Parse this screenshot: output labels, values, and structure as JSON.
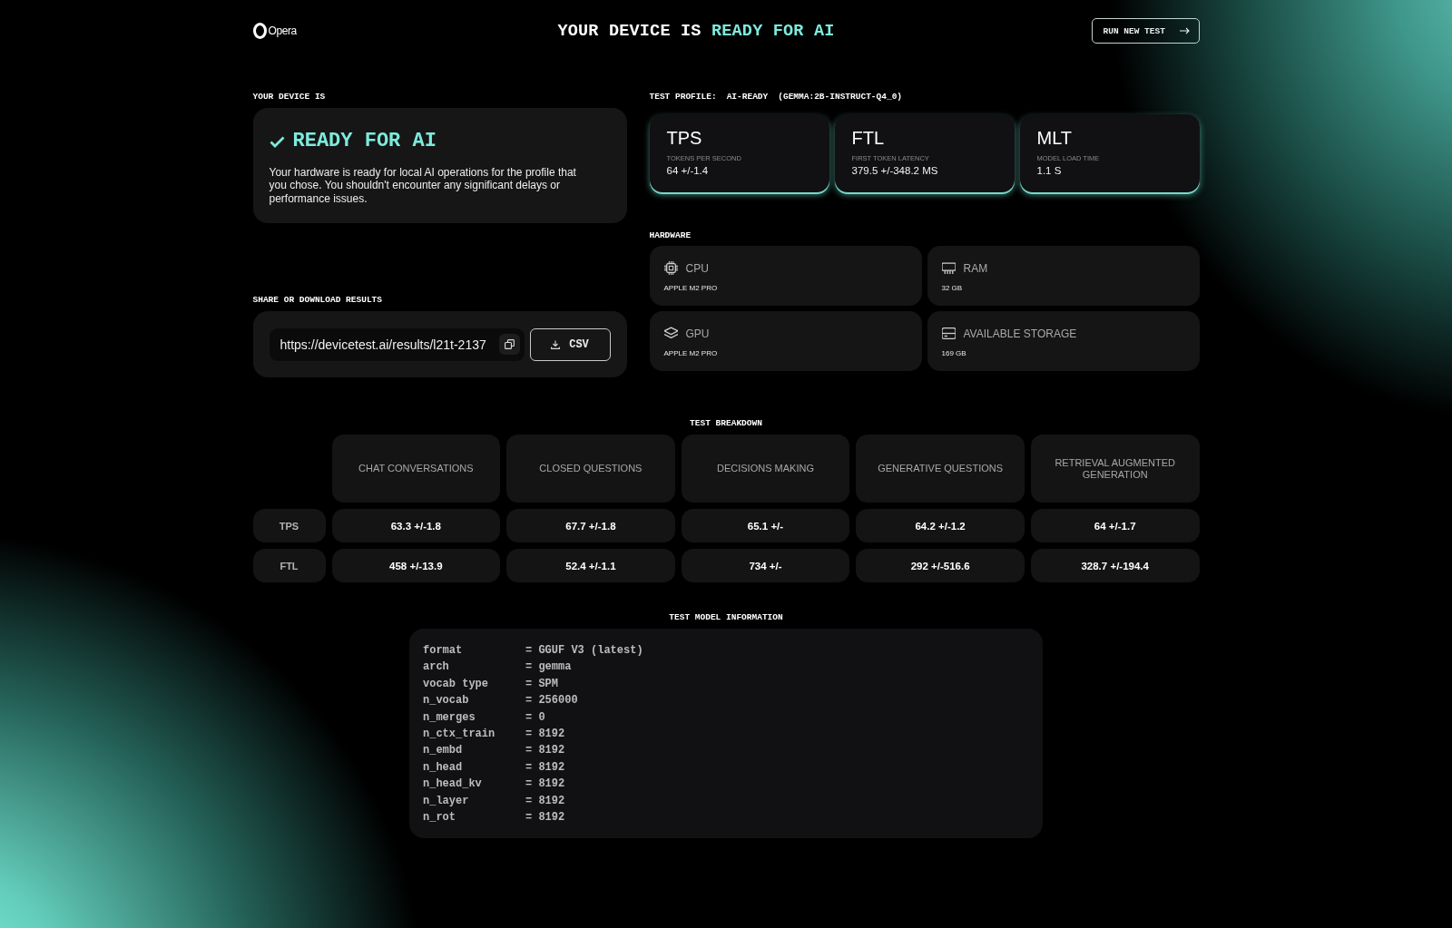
{
  "header": {
    "logo_text": "Opera",
    "title": "YOUR DEVICE IS",
    "title_highlight": "READY FOR AI",
    "button": "RUN NEW TEST"
  },
  "status": {
    "label": "YOUR DEVICE IS",
    "heading": "READY FOR AI",
    "description": "Your hardware is ready for local AI operations for the profile that you chose. You shouldn't encounter any significant delays or performance issues."
  },
  "share": {
    "label": "SHARE OR DOWNLOAD RESULTS",
    "url": "https://devicetest.ai/results/l21t-2137",
    "download_button": "CSV"
  },
  "test_profile": {
    "label": "TEST PROFILE:",
    "profile": "AI-READY",
    "model": "(GEMMA:2B-INSTRUCT-Q4_0)"
  },
  "metrics": [
    {
      "abbr": "TPS",
      "name": "TOKENS PER SECOND",
      "value": "64 +/-1.4"
    },
    {
      "abbr": "FTL",
      "name": "FIRST TOKEN LATENCY",
      "value": "379.5 +/-348.2 MS"
    },
    {
      "abbr": "MLT",
      "name": "MODEL LOAD TIME",
      "value": "1.1 S"
    }
  ],
  "hardware": {
    "label": "HARDWARE",
    "items": [
      {
        "kind": "cpu",
        "name": "CPU",
        "value": "APPLE M2 PRO"
      },
      {
        "kind": "ram",
        "name": "RAM",
        "value": "32 GB"
      },
      {
        "kind": "gpu",
        "name": "GPU",
        "value": "APPLE M2 PRO"
      },
      {
        "kind": "storage",
        "name": "AVAILABLE STORAGE",
        "value": "169 GB"
      }
    ]
  },
  "breakdown": {
    "title": "TEST BREAKDOWN",
    "columns": [
      "CHAT CONVERSATIONS",
      "CLOSED QUESTIONS",
      "DECISIONS MAKING",
      "GENERATIVE QUESTIONS",
      "RETRIEVAL AUGMENTED GENERATION"
    ],
    "rows": [
      {
        "label": "TPS",
        "cells": [
          "63.3 +/-1.8",
          "67.7 +/-1.8",
          "65.1 +/-",
          "64.2 +/-1.2",
          "64 +/-1.7"
        ]
      },
      {
        "label": "FTL",
        "cells": [
          "458 +/-13.9",
          "52.4 +/-1.1",
          "734 +/-",
          "292 +/-516.6",
          "328.7 +/-194.4"
        ]
      }
    ]
  },
  "model_info": {
    "title": "TEST MODEL INFORMATION",
    "rows": [
      {
        "key": "format",
        "value": "= GGUF V3 (latest)"
      },
      {
        "key": "arch",
        "value": "= gemma"
      },
      {
        "key": "vocab type",
        "value": "= SPM"
      },
      {
        "key": "n_vocab",
        "value": "= 256000"
      },
      {
        "key": "n_merges",
        "value": "= 0"
      },
      {
        "key": "n_ctx_train",
        "value": "= 8192"
      },
      {
        "key": "n_embd",
        "value": "= 8192"
      },
      {
        "key": "n_head",
        "value": "= 8192"
      },
      {
        "key": "n_head_kv",
        "value": "= 8192"
      },
      {
        "key": "n_layer",
        "value": "= 8192"
      },
      {
        "key": "n_rot",
        "value": "= 8192"
      }
    ]
  }
}
